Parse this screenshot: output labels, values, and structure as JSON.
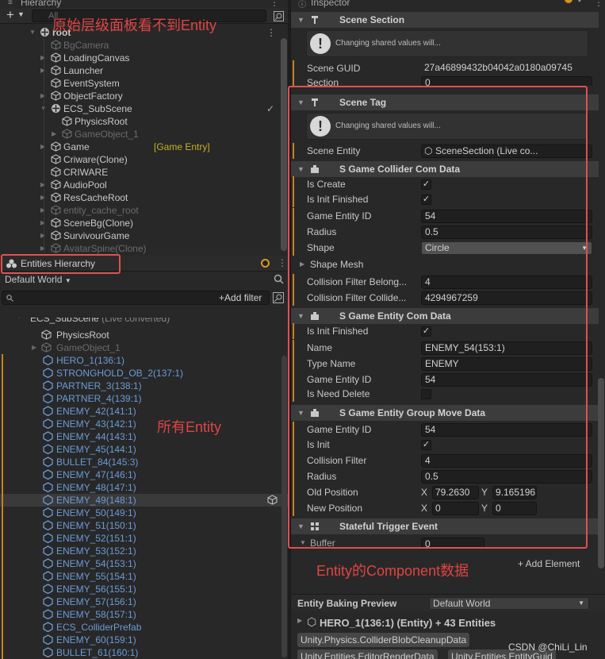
{
  "annotations": {
    "hierarchy_note": "原始层级面板看不到Entity",
    "entities_note": "所有Entity",
    "components_note": "Entity的Component数据",
    "watermark": "CSDN @ChiLi_Lin"
  },
  "hierarchy": {
    "tab_title": "Hierarchy",
    "search_placeholder": "All",
    "items": [
      {
        "label": "root",
        "bold": true
      },
      {
        "label": "BgCamera",
        "dim": true
      },
      {
        "label": "LoadingCanvas"
      },
      {
        "label": "Launcher"
      },
      {
        "label": "EventSystem"
      },
      {
        "label": "ObjectFactory"
      },
      {
        "label": "ECS_SubScene"
      },
      {
        "label": "PhysicsRoot"
      },
      {
        "label": "GameObject_1",
        "dim": true
      },
      {
        "label": "Game",
        "extra": "[Game Entry]"
      },
      {
        "label": "Criware(Clone)"
      },
      {
        "label": "CRIWARE"
      },
      {
        "label": "AudioPool"
      },
      {
        "label": "ResCacheRoot"
      },
      {
        "label": "entity_cache_root",
        "dim": true
      },
      {
        "label": "SceneBg(Clone)"
      },
      {
        "label": "SurvivourGame"
      },
      {
        "label": "AvatarSpine(Clone)",
        "dim": true
      }
    ]
  },
  "entities_hierarchy": {
    "tab_title": "Entities Hierarchy",
    "world": "Default World",
    "add_filter": "Add filter",
    "subscene": "ECS_SubScene",
    "subscene_note": "(Live converted)",
    "rows": [
      {
        "label": "PhysicsRoot",
        "kind": "go"
      },
      {
        "label": "GameObject_1",
        "kind": "go-dim"
      },
      {
        "label": "HERO_1(136:1)",
        "kind": "entity"
      },
      {
        "label": "STRONGHOLD_OB_2(137:1)",
        "kind": "entity"
      },
      {
        "label": "PARTNER_3(138:1)",
        "kind": "entity"
      },
      {
        "label": "PARTNER_4(139:1)",
        "kind": "entity"
      },
      {
        "label": "ENEMY_42(141:1)",
        "kind": "entity"
      },
      {
        "label": "ENEMY_43(142:1)",
        "kind": "entity"
      },
      {
        "label": "ENEMY_44(143:1)",
        "kind": "entity"
      },
      {
        "label": "ENEMY_45(144:1)",
        "kind": "entity"
      },
      {
        "label": "BULLET_84(145:3)",
        "kind": "entity"
      },
      {
        "label": "ENEMY_47(146:1)",
        "kind": "entity"
      },
      {
        "label": "ENEMY_48(147:1)",
        "kind": "entity"
      },
      {
        "label": "ENEMY_49(148:1)",
        "kind": "entity",
        "selected": true
      },
      {
        "label": "ENEMY_50(149:1)",
        "kind": "entity"
      },
      {
        "label": "ENEMY_51(150:1)",
        "kind": "entity"
      },
      {
        "label": "ENEMY_52(151:1)",
        "kind": "entity"
      },
      {
        "label": "ENEMY_53(152:1)",
        "kind": "entity"
      },
      {
        "label": "ENEMY_54(153:1)",
        "kind": "entity"
      },
      {
        "label": "ENEMY_55(154:1)",
        "kind": "entity"
      },
      {
        "label": "ENEMY_56(155:1)",
        "kind": "entity"
      },
      {
        "label": "ENEMY_57(156:1)",
        "kind": "entity"
      },
      {
        "label": "ENEMY_58(157:1)",
        "kind": "entity"
      },
      {
        "label": "ECS_ColliderPrefab",
        "kind": "entity"
      },
      {
        "label": "ENEMY_60(159:1)",
        "kind": "entity"
      },
      {
        "label": "BULLET_61(160:1)",
        "kind": "entity"
      }
    ]
  },
  "inspector": {
    "tab_title": "Inspector",
    "help_text": "Changing shared values will...",
    "scene_section": {
      "title": "Scene Section",
      "guid_label": "Scene GUID",
      "guid_value": "27a46899432b04042a0180a09745",
      "section_label": "Section",
      "section_value": "0"
    },
    "scene_tag": {
      "title": "Scene Tag",
      "entity_label": "Scene Entity",
      "entity_value": "SceneSection (Live co..."
    },
    "collider": {
      "title": "S Game Collider Com Data",
      "is_create_label": "Is Create",
      "is_init_label": "Is Init Finished",
      "entity_id_label": "Game Entity ID",
      "entity_id_value": "54",
      "radius_label": "Radius",
      "radius_value": "0.5",
      "shape_label": "Shape",
      "shape_value": "Circle",
      "mesh_label": "Shape Mesh",
      "belongs_label": "Collision Filter Belong...",
      "belongs_value": "4",
      "collides_label": "Collision Filter Collide...",
      "collides_value": "4294967259"
    },
    "entity_com": {
      "title": "S Game Entity Com Data",
      "is_init_label": "Is Init Finished",
      "name_label": "Name",
      "name_value": "ENEMY_54(153:1)",
      "type_label": "Type Name",
      "type_value": "ENEMY",
      "entity_id_label": "Game Entity ID",
      "entity_id_value": "54",
      "need_delete_label": "Is Need Delete"
    },
    "group_move": {
      "title": "S Game Entity Group Move Data",
      "entity_id_label": "Game Entity ID",
      "entity_id_value": "54",
      "is_init_label": "Is Init",
      "filter_label": "Collision Filter",
      "filter_value": "4",
      "radius_label": "Radius",
      "radius_value": "0.5",
      "old_pos_label": "Old Position",
      "old_x": "79.2630",
      "old_y": "9.165196",
      "new_pos_label": "New Position",
      "new_x": "0",
      "new_y": "0",
      "x_axis": "X",
      "y_axis": "Y"
    },
    "trigger": {
      "title": "Stateful Trigger Event",
      "buffer_label": "Buffer",
      "buffer_value": "0"
    },
    "add_element": "+ Add Element"
  },
  "baking": {
    "title": "Entity Baking Preview",
    "world": "Default World",
    "summary": "HERO_1(136:1) (Entity) + 43 Entities",
    "tags": [
      "Unity.Physics.ColliderBlobCleanupData",
      "Unity.Entities.EditorRenderData",
      "Unity.Entities.EntityGuid"
    ]
  }
}
